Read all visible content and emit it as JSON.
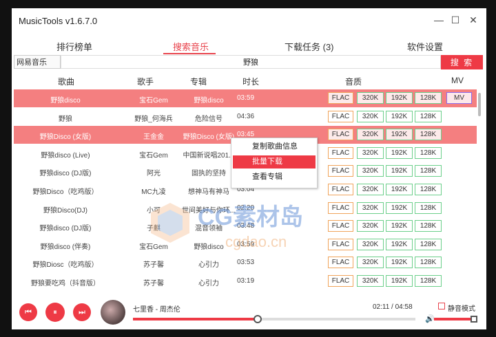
{
  "app": {
    "title": "MusicTools v1.6.7.0"
  },
  "window_controls": {
    "minimize": "—",
    "maximize": "☐",
    "close": "✕"
  },
  "tabs": [
    {
      "label": "排行榜单"
    },
    {
      "label": "搜索音乐"
    },
    {
      "label": "下载任务 (3)"
    },
    {
      "label": "软件设置"
    }
  ],
  "search": {
    "source": "网易音乐",
    "query": "野狼",
    "button": "搜 索"
  },
  "columns": {
    "song": "歌曲",
    "artist": "歌手",
    "album": "专辑",
    "duration": "时长",
    "quality": "音质",
    "mv": "MV"
  },
  "quality_labels": {
    "flac": "FLAC",
    "q320": "320K",
    "q192": "192K",
    "q128": "128K"
  },
  "rows": [
    {
      "song": "野狼disco",
      "artist": "宝石Gem",
      "album": "野狼disco",
      "duration": "03:59",
      "mv": "MV"
    },
    {
      "song": "野狼",
      "artist": "野狼_何海兵",
      "album": "危险信号",
      "duration": "04:36",
      "mv": ""
    },
    {
      "song": "野狼Disco (女版)",
      "artist": "王金金",
      "album": "野狼Disco (女版)",
      "duration": "03:45",
      "mv": ""
    },
    {
      "song": "野狼disco (Live)",
      "artist": "宝石Gem",
      "album": "中国新说唱201...",
      "duration": "",
      "mv": ""
    },
    {
      "song": "野狼disco (DJ版)",
      "artist": "阿光",
      "album": "固执的坚持",
      "duration": "",
      "mv": ""
    },
    {
      "song": "野狼Disco（吃鸡版）",
      "artist": "MC九凌",
      "album": "想神马有神马",
      "duration": "03:04",
      "mv": ""
    },
    {
      "song": "野狼Disco(DJ)",
      "artist": "小可",
      "album": "世间美好与你环...",
      "duration": "02:20",
      "mv": ""
    },
    {
      "song": "野狼disco (DJ版)",
      "artist": "子麒",
      "album": "混音领袖",
      "duration": "03:48",
      "mv": ""
    },
    {
      "song": "野狼disco (伴奏)",
      "artist": "宝石Gem",
      "album": "野狼disco",
      "duration": "03:59",
      "mv": ""
    },
    {
      "song": "野狼Diosc（吃鸡版）",
      "artist": "苏子馨",
      "album": "心引力",
      "duration": "03:53",
      "mv": ""
    },
    {
      "song": "野狼要吃鸡（抖音版）",
      "artist": "苏子馨",
      "album": "心引力",
      "duration": "03:19",
      "mv": ""
    }
  ],
  "context_menu": {
    "items": [
      "复制歌曲信息",
      "批量下载",
      "查看专辑"
    ]
  },
  "watermark": {
    "brand": "CG素材岛",
    "url": "cgdao.cn"
  },
  "player": {
    "prev": "⏮",
    "pause": "⏸",
    "next": "⏭",
    "song": "七里香 - 周杰伦",
    "time": "02:11 / 04:58",
    "progress": 0.44,
    "volume": 0.95,
    "mute_label": "静音模式",
    "volume_icon": "🔊"
  },
  "colors": {
    "accent": "#ee3a45",
    "selected_row": "#f47f80",
    "flac_border": "#f0a45b",
    "quality_border": "#6bcf8a",
    "mv_border": "#8a6df0"
  }
}
